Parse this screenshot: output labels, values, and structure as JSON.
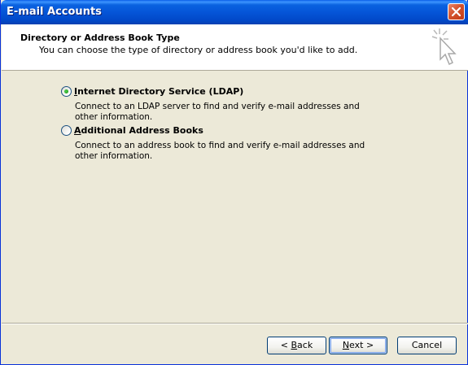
{
  "window": {
    "title": "E-mail Accounts"
  },
  "header": {
    "heading": "Directory or Address Book Type",
    "subheading": "You can choose the type of directory or address book you'd like to add."
  },
  "options": [
    {
      "accel": "I",
      "label_rest": "nternet Directory Service (LDAP)",
      "description": "Connect to an LDAP server to find and verify e-mail addresses and other information.",
      "selected": true
    },
    {
      "accel": "A",
      "label_rest": "dditional Address Books",
      "description": "Connect to an address book to find and verify e-mail addresses and other information.",
      "selected": false
    }
  ],
  "buttons": {
    "back": {
      "lead": "< ",
      "accel": "B",
      "rest": "ack"
    },
    "next": {
      "accel": "N",
      "rest": "ext >"
    },
    "cancel": {
      "label": "Cancel"
    }
  },
  "colors": {
    "titlebar": "#0555d8",
    "dialog_bg": "#ece9d8",
    "header_bg": "#ffffff",
    "radio_dot": "#21a121"
  },
  "icons": {
    "close": "close-icon",
    "wizard": "wizard-cursor-icon"
  }
}
